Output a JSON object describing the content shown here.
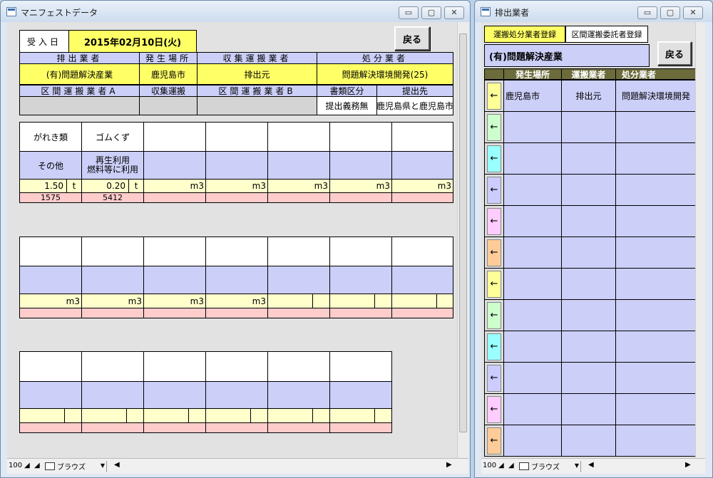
{
  "manifest_window": {
    "title": "マニフェストデータ",
    "controls": {
      "minimize": "▭",
      "maximize": "▢",
      "close": "✕"
    },
    "received_label": "受入日",
    "received_date": "2015年02月10日(火)",
    "back_button": "戻る",
    "header_row1": [
      "排出業者",
      "発生場所",
      "収集運搬業者",
      "処分業者"
    ],
    "values_row1": [
      "(有)問題解決産業",
      "鹿児島市",
      "排出元",
      "問題解決環境開発(25)"
    ],
    "header_row2": [
      "区間運搬業者A",
      "収集運搬",
      "区間運搬業者B",
      "書類区分",
      "提出先"
    ],
    "values_row2": [
      "",
      "",
      "",
      "提出義務無",
      "鹿児島県と鹿児島市"
    ],
    "waste_items": [
      {
        "name": "がれき類",
        "category": "その他",
        "qty": "1.50",
        "unit": "t",
        "code": "1575"
      },
      {
        "name": "ゴムくず",
        "category_line1": "再生利用",
        "category_line2": "燃料等に利用",
        "qty": "0.20",
        "unit": "t",
        "code": "5412"
      }
    ],
    "unit_m3": "m3",
    "status": {
      "zoom": "100",
      "mode": "ブラウズ"
    }
  },
  "discharger_window": {
    "title": "排出業者",
    "controls": {
      "minimize": "▭",
      "maximize": "▢",
      "close": "✕"
    },
    "tab_transport": "運搬処分業者登録",
    "tab_section": "区間運搬委託者登録",
    "company_name": "(有)問題解決産業",
    "back_button": "戻る",
    "columns": [
      "発生場所",
      "運搬業者",
      "処分業者"
    ],
    "first_row": [
      "鹿児島市",
      "排出元",
      "問題解決環境開発"
    ],
    "arrow": "←",
    "arrow_colors": [
      "#ffff99",
      "#ccffcc",
      "#99ffff",
      "#ccccff",
      "#ffccff",
      "#ffcc99",
      "#ffff99",
      "#ccffcc",
      "#99ffff",
      "#ccccff",
      "#ffccff",
      "#ffcc99"
    ],
    "status": {
      "zoom": "100",
      "mode": "ブラウズ"
    }
  }
}
